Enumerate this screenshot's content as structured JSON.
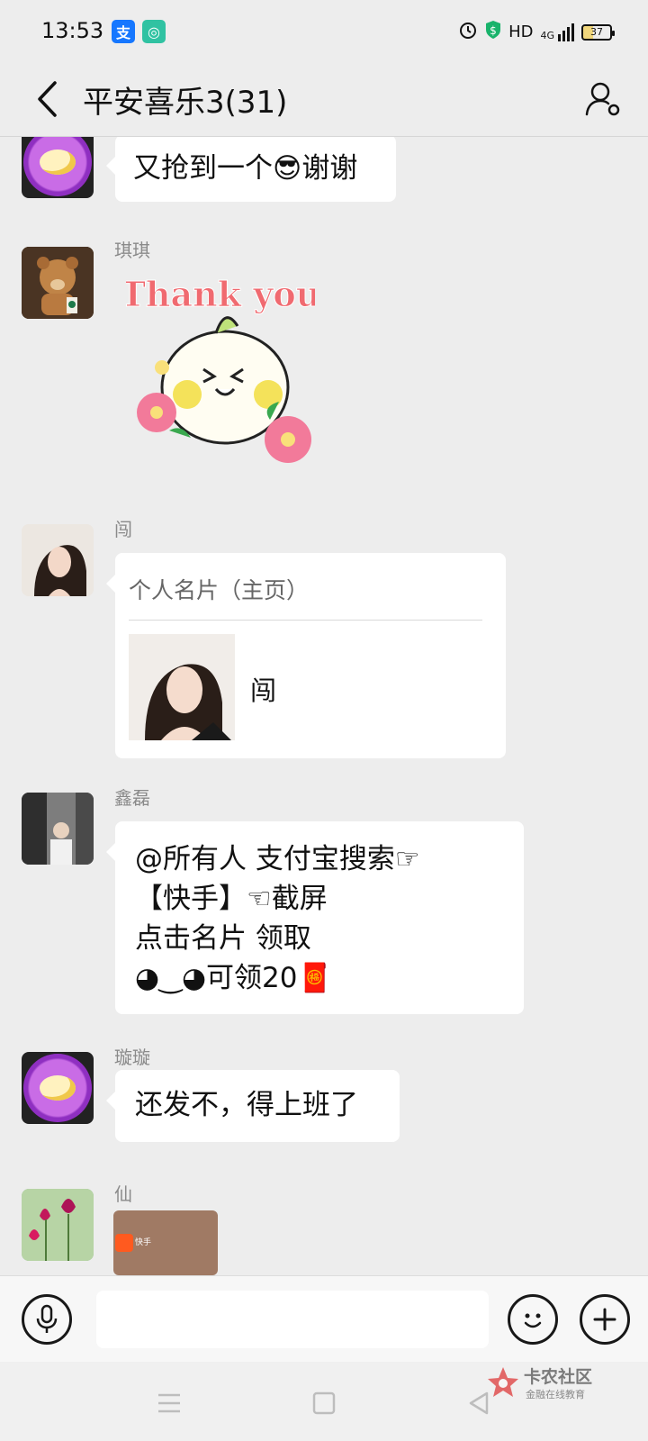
{
  "status_bar": {
    "time": "13:53",
    "network": "HD",
    "signal": "4G",
    "battery": "37"
  },
  "header": {
    "title": "平安喜乐3(31)"
  },
  "messages": [
    {
      "text": "又抢到一个😎谢谢"
    },
    {
      "sender": "琪琪",
      "sticker_text": "Thank you"
    },
    {
      "sender": "闯",
      "card_title": "个人名片（主页）",
      "card_name": "闯"
    },
    {
      "sender": "鑫磊",
      "lines": [
        "@所有人 支付宝搜索☞",
        "【快手】☜截屏",
        "点击名片  领取",
        "◕‿◕可领20🧧"
      ]
    },
    {
      "sender": "璇璇",
      "text": "还发不，得上班了"
    },
    {
      "sender": "仙",
      "preview_text": "快手"
    }
  ],
  "input": {
    "placeholder": ""
  },
  "watermark": {
    "title": "卡农社区",
    "subtitle": "金融在线教育"
  },
  "colors": {
    "background": "#ededed",
    "bubble": "#ffffff",
    "sender": "#8a8a8a",
    "sticker_text": "#f06a70"
  }
}
